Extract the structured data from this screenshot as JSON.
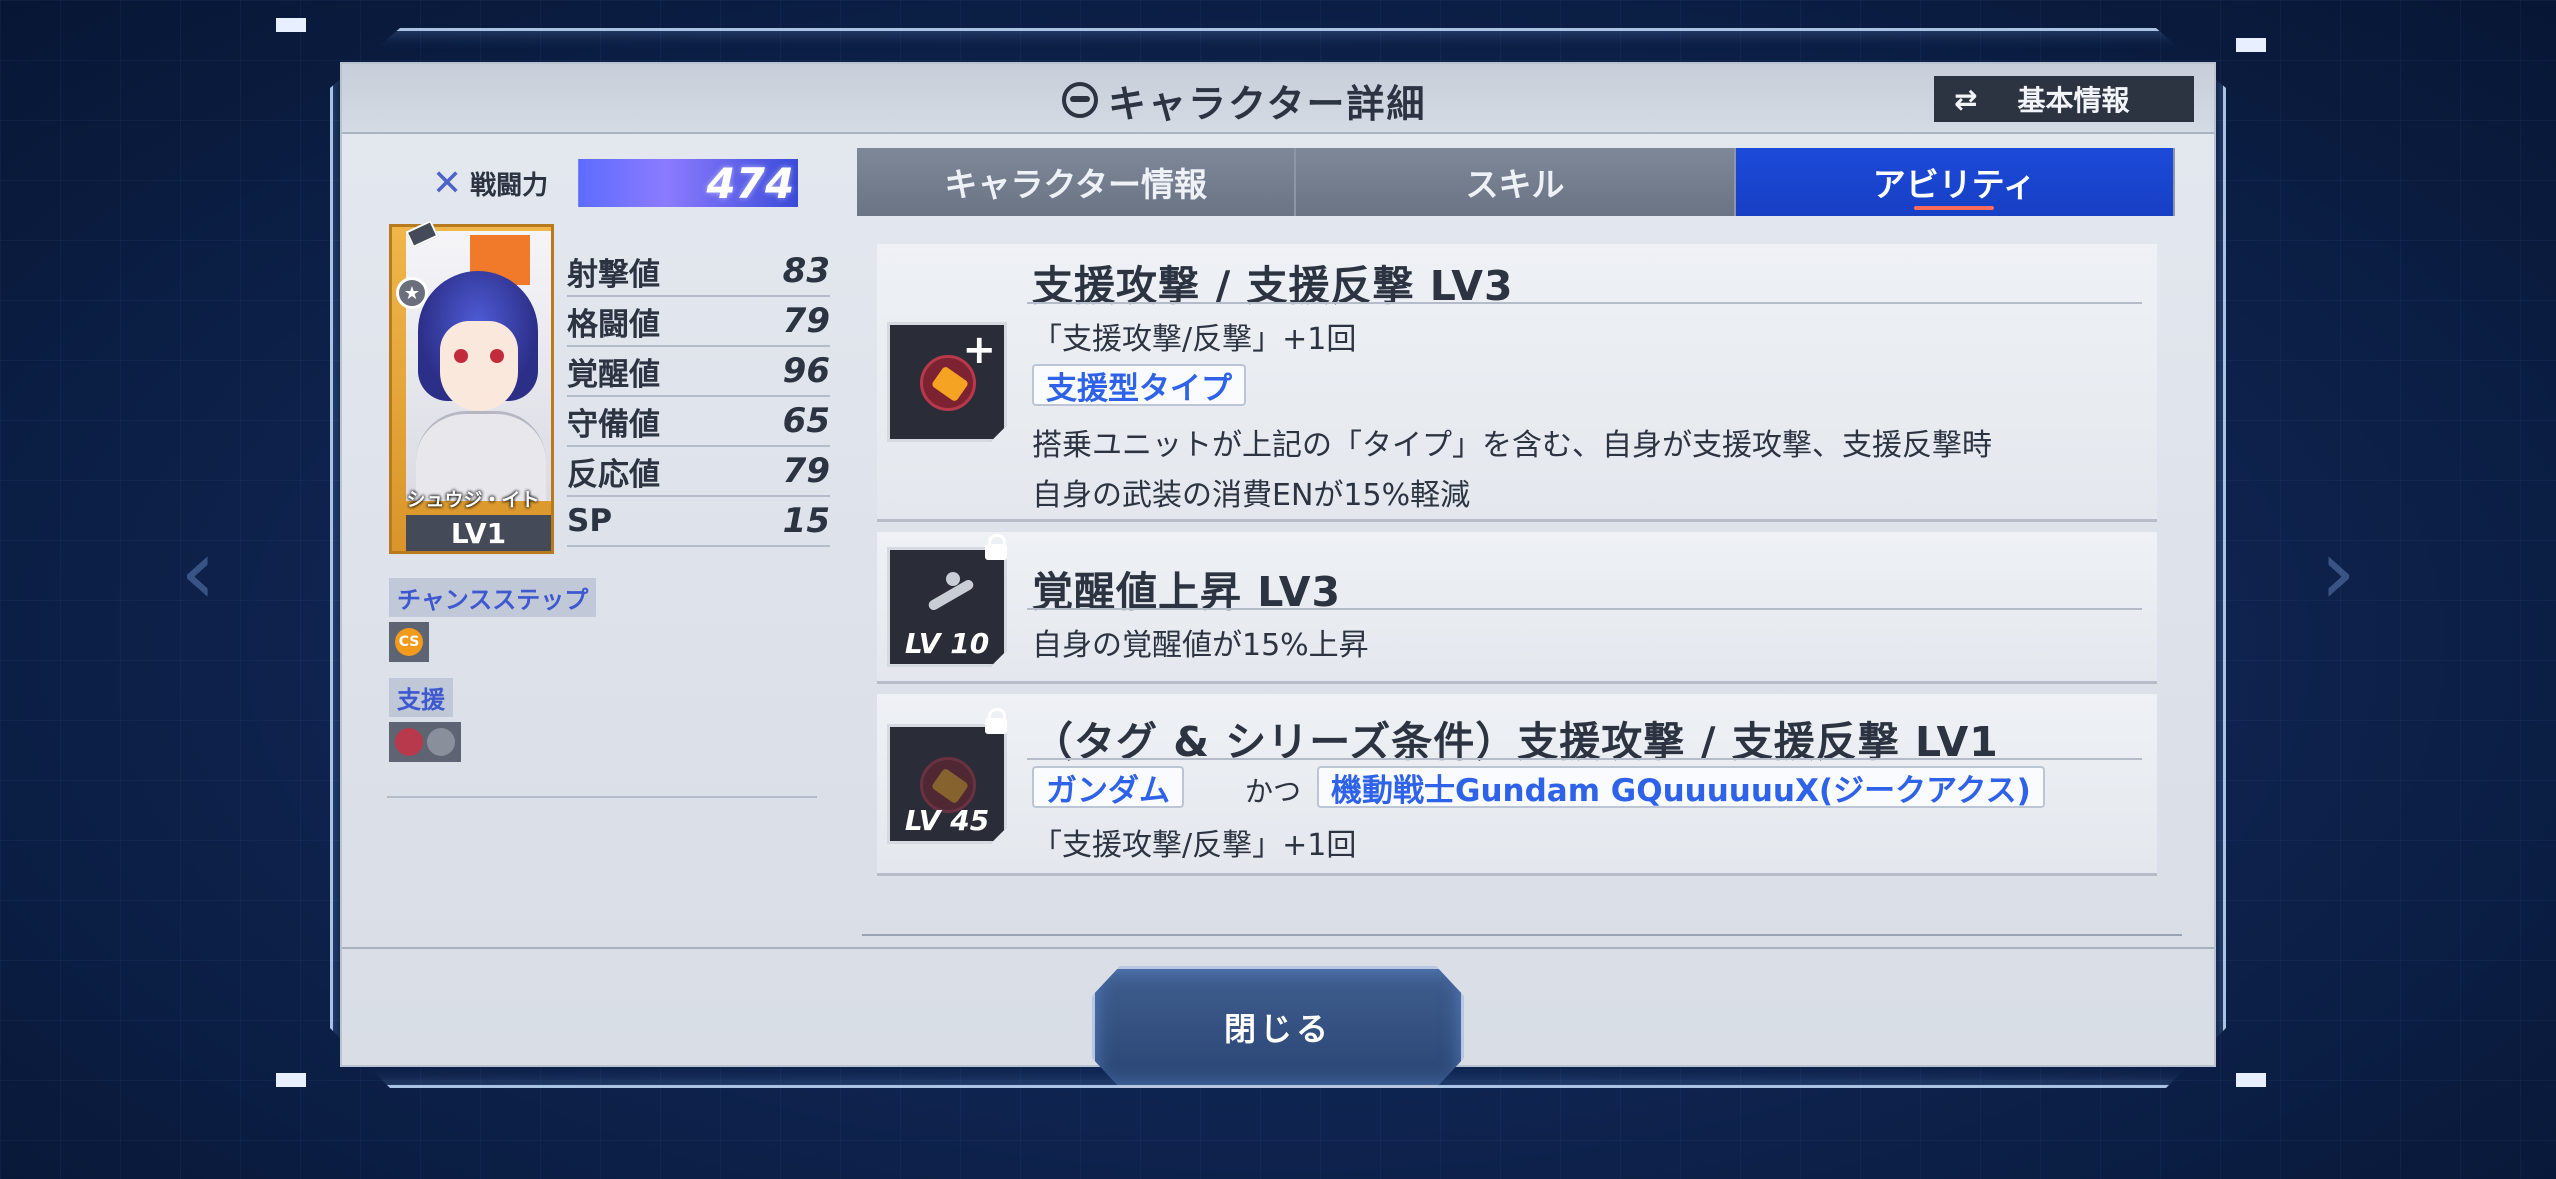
{
  "header": {
    "title": "キャラクター詳細",
    "basic_info_label": "基本情報"
  },
  "power": {
    "label": "戦闘力",
    "value": "474"
  },
  "character": {
    "name": "シュウジ・イト",
    "level": "LV1"
  },
  "stats": [
    {
      "label": "射撃値",
      "value": "83"
    },
    {
      "label": "格闘値",
      "value": "79"
    },
    {
      "label": "覚醒値",
      "value": "96"
    },
    {
      "label": "守備値",
      "value": "65"
    },
    {
      "label": "反応値",
      "value": "79"
    },
    {
      "label": "SP",
      "value": "15"
    }
  ],
  "sections": {
    "chance_step": "チャンスステップ",
    "chance_step_icon": "CS",
    "support": "支援"
  },
  "tabs": [
    {
      "label": "キャラクター情報",
      "active": false
    },
    {
      "label": "スキル",
      "active": false
    },
    {
      "label": "アビリティ",
      "active": true
    }
  ],
  "abilities": [
    {
      "title": "支援攻撃 / 支援反撃 LV3",
      "line1": "「支援攻撃/反撃」+1回",
      "tag": "支援型タイプ",
      "desc1": "搭乗ユニットが上記の「タイプ」を含む、自身が支援攻撃、支援反撃時",
      "desc2": "自身の武装の消費ENが15%軽減"
    },
    {
      "title": "覚醒値上昇 LV3",
      "desc": "自身の覚醒値が15%上昇",
      "unlock_level": "LV 10"
    },
    {
      "title": "（タグ & シリーズ条件）支援攻撃 / 支援反撃 LV1",
      "tag1": "ガンダム",
      "conj": "かつ",
      "tag2": "機動戦士Gundam GQuuuuuuX(ジークアクス)",
      "line1": "「支援攻撃/反撃」+1回",
      "unlock_level": "LV 45"
    }
  ],
  "footer": {
    "close_label": "閉じる"
  },
  "colors": {
    "accent": "#1c4ad9",
    "tag_text": "#2e62e8",
    "card_gold": "#f0b64a"
  }
}
